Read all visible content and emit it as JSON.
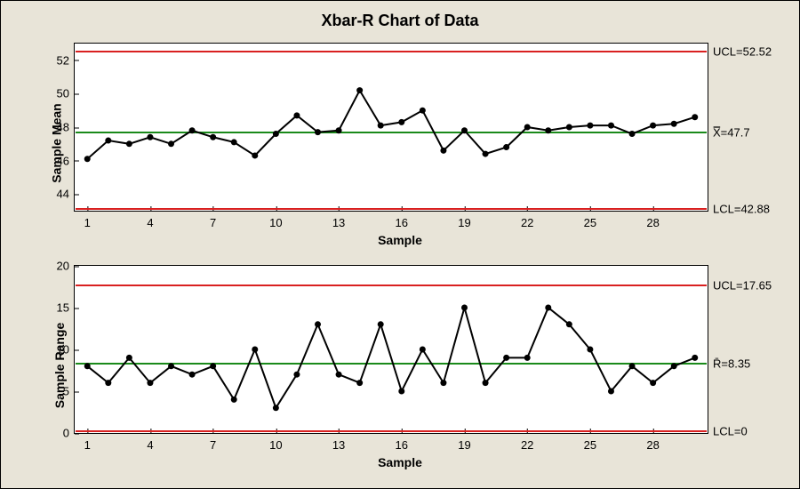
{
  "title": "Xbar-R Chart of Data",
  "chart_data": [
    {
      "type": "line",
      "name": "xbar",
      "title": "",
      "xlabel": "Sample",
      "ylabel": "Sample Mean",
      "ylim": [
        43,
        53
      ],
      "yticks": [
        44,
        46,
        48,
        50,
        52
      ],
      "xlim": [
        1,
        30
      ],
      "xticks": [
        1,
        4,
        7,
        10,
        13,
        16,
        19,
        22,
        25,
        28
      ],
      "reference_lines": [
        {
          "value": 52.52,
          "color": "red",
          "label": "UCL=52.52"
        },
        {
          "value": 47.7,
          "color": "green",
          "label": "X̿=47.7"
        },
        {
          "value": 42.88,
          "color": "red",
          "label": "LCL=42.88"
        }
      ],
      "x": [
        1,
        2,
        3,
        4,
        5,
        6,
        7,
        8,
        9,
        10,
        11,
        12,
        13,
        14,
        15,
        16,
        17,
        18,
        19,
        20,
        21,
        22,
        23,
        24,
        25,
        26,
        27,
        28,
        29,
        30
      ],
      "values": [
        46.1,
        47.2,
        47.0,
        47.4,
        47.0,
        47.8,
        47.4,
        47.1,
        46.3,
        47.6,
        48.7,
        47.7,
        47.8,
        50.2,
        48.1,
        48.3,
        49.0,
        46.6,
        47.8,
        46.4,
        46.8,
        48.0,
        47.8,
        48.0,
        48.1,
        48.1,
        47.6,
        48.1,
        48.2,
        48.6
      ]
    },
    {
      "type": "line",
      "name": "r",
      "title": "",
      "xlabel": "Sample",
      "ylabel": "Sample Range",
      "ylim": [
        0,
        20
      ],
      "yticks": [
        0,
        5,
        10,
        15,
        20
      ],
      "xlim": [
        1,
        30
      ],
      "xticks": [
        1,
        4,
        7,
        10,
        13,
        16,
        19,
        22,
        25,
        28
      ],
      "reference_lines": [
        {
          "value": 17.65,
          "color": "red",
          "label": "UCL=17.65"
        },
        {
          "value": 8.35,
          "color": "green",
          "label": "R̄=8.35"
        },
        {
          "value": 0,
          "color": "red",
          "label": "LCL=0"
        }
      ],
      "x": [
        1,
        2,
        3,
        4,
        5,
        6,
        7,
        8,
        9,
        10,
        11,
        12,
        13,
        14,
        15,
        16,
        17,
        18,
        19,
        20,
        21,
        22,
        23,
        24,
        25,
        26,
        27,
        28,
        29,
        30
      ],
      "values": [
        8,
        6,
        9,
        6,
        8,
        7,
        8,
        4,
        10,
        3,
        7,
        13,
        7,
        6,
        13,
        5,
        10,
        6,
        15,
        6,
        9,
        9,
        15,
        13,
        10,
        5,
        8,
        6,
        8,
        9
      ]
    }
  ]
}
